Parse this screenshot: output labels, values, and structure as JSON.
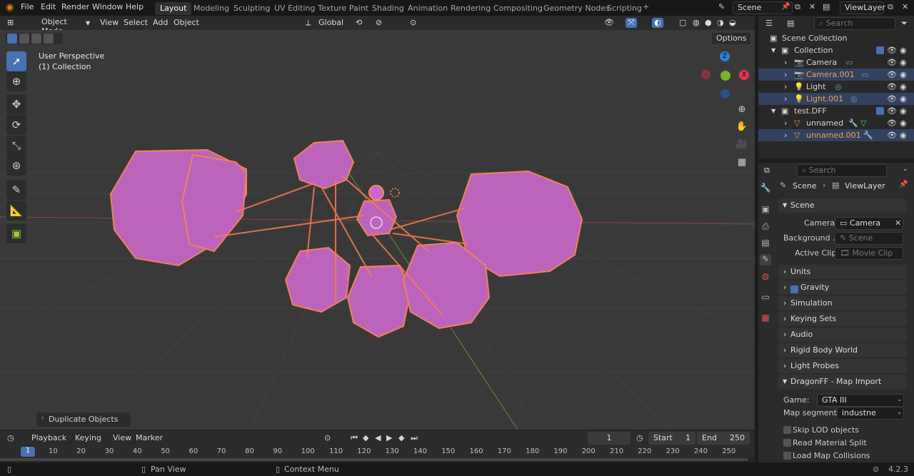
{
  "app": {
    "menus": [
      "File",
      "Edit",
      "Render",
      "Window",
      "Help"
    ],
    "workspaces": [
      "Layout",
      "Modeling",
      "Sculpting",
      "UV Editing",
      "Texture Paint",
      "Shading",
      "Animation",
      "Rendering",
      "Compositing",
      "Geometry Nodes",
      "Scripting"
    ],
    "active_workspace": "Layout",
    "scene_name": "Scene",
    "view_layer": "ViewLayer"
  },
  "viewport": {
    "mode": "Object Mode",
    "menus": [
      "View",
      "Select",
      "Add",
      "Object"
    ],
    "orientation": "Global",
    "options": "Options",
    "overlay_title": "User Perspective",
    "overlay_subtitle": "(1) Collection",
    "last_op": "Duplicate Objects",
    "gizmo": {
      "z": "Z",
      "x": "X"
    }
  },
  "outliner": {
    "search_placeholder": "Search",
    "root": "Scene Collection",
    "rows": [
      {
        "label": "Collection",
        "selected": false,
        "orange": false
      },
      {
        "label": "Camera",
        "selected": false,
        "orange": false
      },
      {
        "label": "Camera.001",
        "selected": true,
        "orange": true
      },
      {
        "label": "Light",
        "selected": false,
        "orange": false
      },
      {
        "label": "Light.001",
        "selected": true,
        "orange": true
      },
      {
        "label": "test.DFF",
        "selected": false,
        "orange": false
      },
      {
        "label": "unnamed",
        "selected": false,
        "orange": false
      },
      {
        "label": "unnamed.001",
        "selected": true,
        "orange": true
      }
    ]
  },
  "properties": {
    "search_placeholder": "Search",
    "breadcrumb_scene": "Scene",
    "breadcrumb_layer": "ViewLayer",
    "scene_panel": "Scene",
    "camera_label": "Camera",
    "camera_value": "Camera",
    "background_label": "Background ...",
    "background_placeholder": "Scene",
    "clip_label": "Active Clip",
    "clip_placeholder": "Movie Clip",
    "sections": [
      "Units",
      "Gravity",
      "Simulation",
      "Keying Sets",
      "Audio",
      "Rigid Body World",
      "Light Probes",
      "DragonFF - Map Import"
    ],
    "game_label": "Game:",
    "game_value": "GTA III",
    "segment_label": "Map segment:",
    "segment_value": "industne",
    "checkboxes": [
      "Skip LOD objects",
      "Read Material Split",
      "Load Map Collisions"
    ]
  },
  "timeline": {
    "menus": [
      "Playback",
      "Keying",
      "View",
      "Marker"
    ],
    "current_frame": "1",
    "start_label": "Start",
    "start": "1",
    "end_label": "End",
    "end": "250",
    "ticks": [
      "1",
      "10",
      "20",
      "30",
      "40",
      "50",
      "60",
      "70",
      "80",
      "90",
      "100",
      "110",
      "120",
      "130",
      "140",
      "150",
      "160",
      "170",
      "180",
      "190",
      "200",
      "210",
      "220",
      "230",
      "240",
      "250"
    ]
  },
  "status": {
    "pan": "Pan View",
    "context": "Context Menu",
    "version": "4.2.3"
  }
}
